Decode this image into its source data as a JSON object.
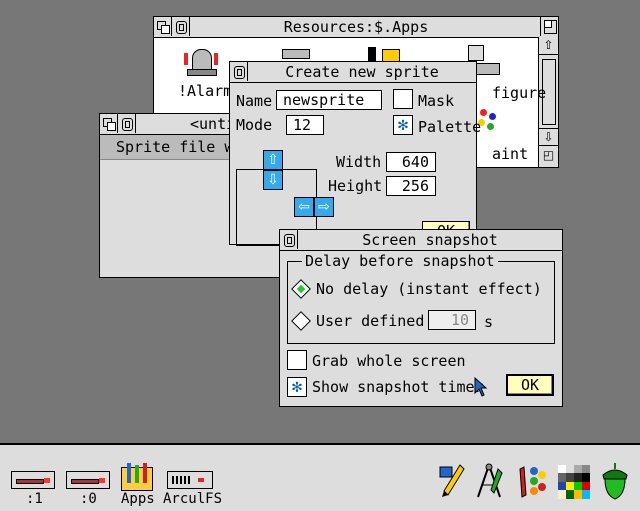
{
  "resources_window": {
    "title": "Resources:$.Apps",
    "items": [
      "!Alarm",
      "figure",
      "aint"
    ]
  },
  "untitled_window": {
    "title": "<unti",
    "content": "Sprite file wi"
  },
  "create_sprite": {
    "title": "Create new sprite",
    "name_label": "Name",
    "name_value": "newsprite",
    "mask_label": "Mask",
    "mode_label": "Mode",
    "mode_value": "12",
    "palette_label": "Palette",
    "width_label": "Width",
    "width_value": "640",
    "height_label": "Height",
    "height_value": "256",
    "ok_label": "OK"
  },
  "snapshot": {
    "title": "Screen snapshot",
    "group_label": "Delay before snapshot",
    "no_delay_label": "No delay (instant effect)",
    "user_defined_label": "User defined",
    "delay_value": "10",
    "delay_unit": "s",
    "grab_label": "Grab whole screen",
    "timer_label": "Show snapshot timer",
    "ok_label": "OK"
  },
  "iconbar": {
    "drive1_label": ":1",
    "drive0_label": ":0",
    "apps_label": "Apps",
    "arculfs_label": "ArculFS"
  },
  "colors": {
    "desktop": "#777777",
    "window": "#dddddd",
    "accent": "#33aaee",
    "ok_button": "#ffffbb"
  }
}
